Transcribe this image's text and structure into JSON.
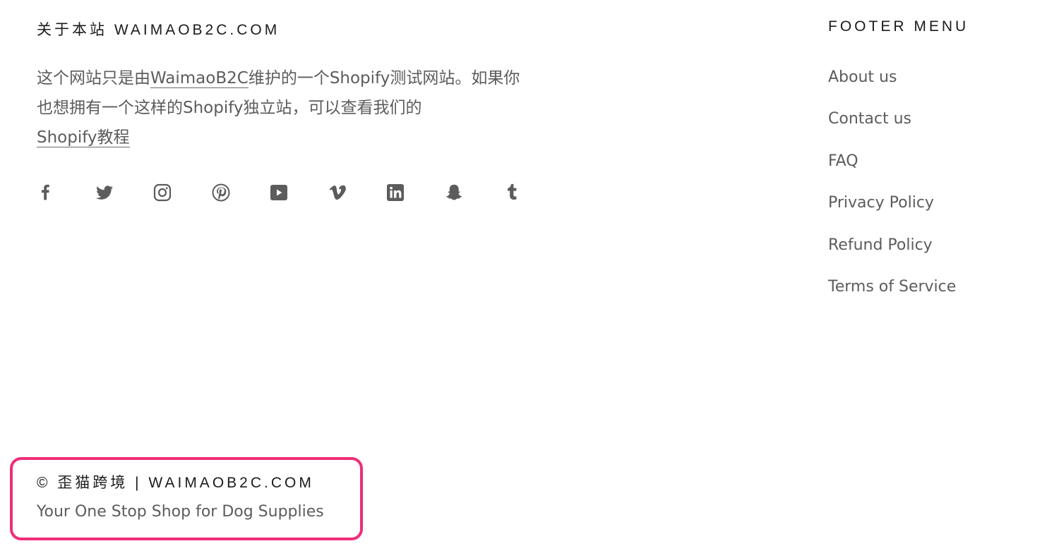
{
  "about": {
    "heading": "关于本站 WAIMAOB2C.COM",
    "text_part1": "这个网站只是由",
    "link1": "WaimaoB2C",
    "text_part2": "维护的一个Shopify测试网站。如果你也想拥有一个这样的Shopify独立站，可以查看我们的",
    "link2": "Shopify教程"
  },
  "social": {
    "icons": [
      "facebook-icon",
      "twitter-icon",
      "instagram-icon",
      "pinterest-icon",
      "youtube-icon",
      "vimeo-icon",
      "linkedin-icon",
      "snapchat-icon",
      "tumblr-icon"
    ],
    "icon_color": "#5c5c5c"
  },
  "footer_menu": {
    "heading": "FOOTER MENU",
    "items": [
      {
        "label": "About us"
      },
      {
        "label": "Contact us"
      },
      {
        "label": "FAQ"
      },
      {
        "label": "Privacy Policy"
      },
      {
        "label": "Refund Policy"
      },
      {
        "label": "Terms of Service"
      }
    ]
  },
  "copyright": {
    "text": "© 歪猫跨境 | WAIMAOB2C.COM",
    "tagline": "Your One Stop Shop for Dog Supplies",
    "highlight_color": "#ef2d78"
  }
}
